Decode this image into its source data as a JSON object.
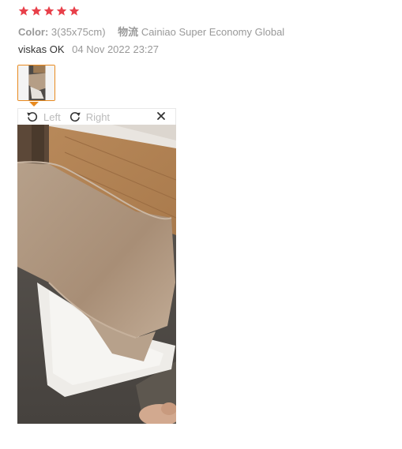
{
  "review": {
    "rating": 5,
    "rating_max": 5,
    "star_color": "#e8404a",
    "color_label": "Color:",
    "color_value": "3(35x75cm)",
    "shipping_label": "物流",
    "shipping_value": "Cainiao Super Economy Global",
    "user": "viskas OK",
    "date": "04 Nov 2022 23:27"
  },
  "viewer": {
    "rotate_left_label": "Left",
    "rotate_right_label": "Right",
    "accent_color": "#e88a1f",
    "icons": {
      "rotate_left": "rotate-left-icon",
      "rotate_right": "rotate-right-icon",
      "close": "close-icon"
    }
  }
}
